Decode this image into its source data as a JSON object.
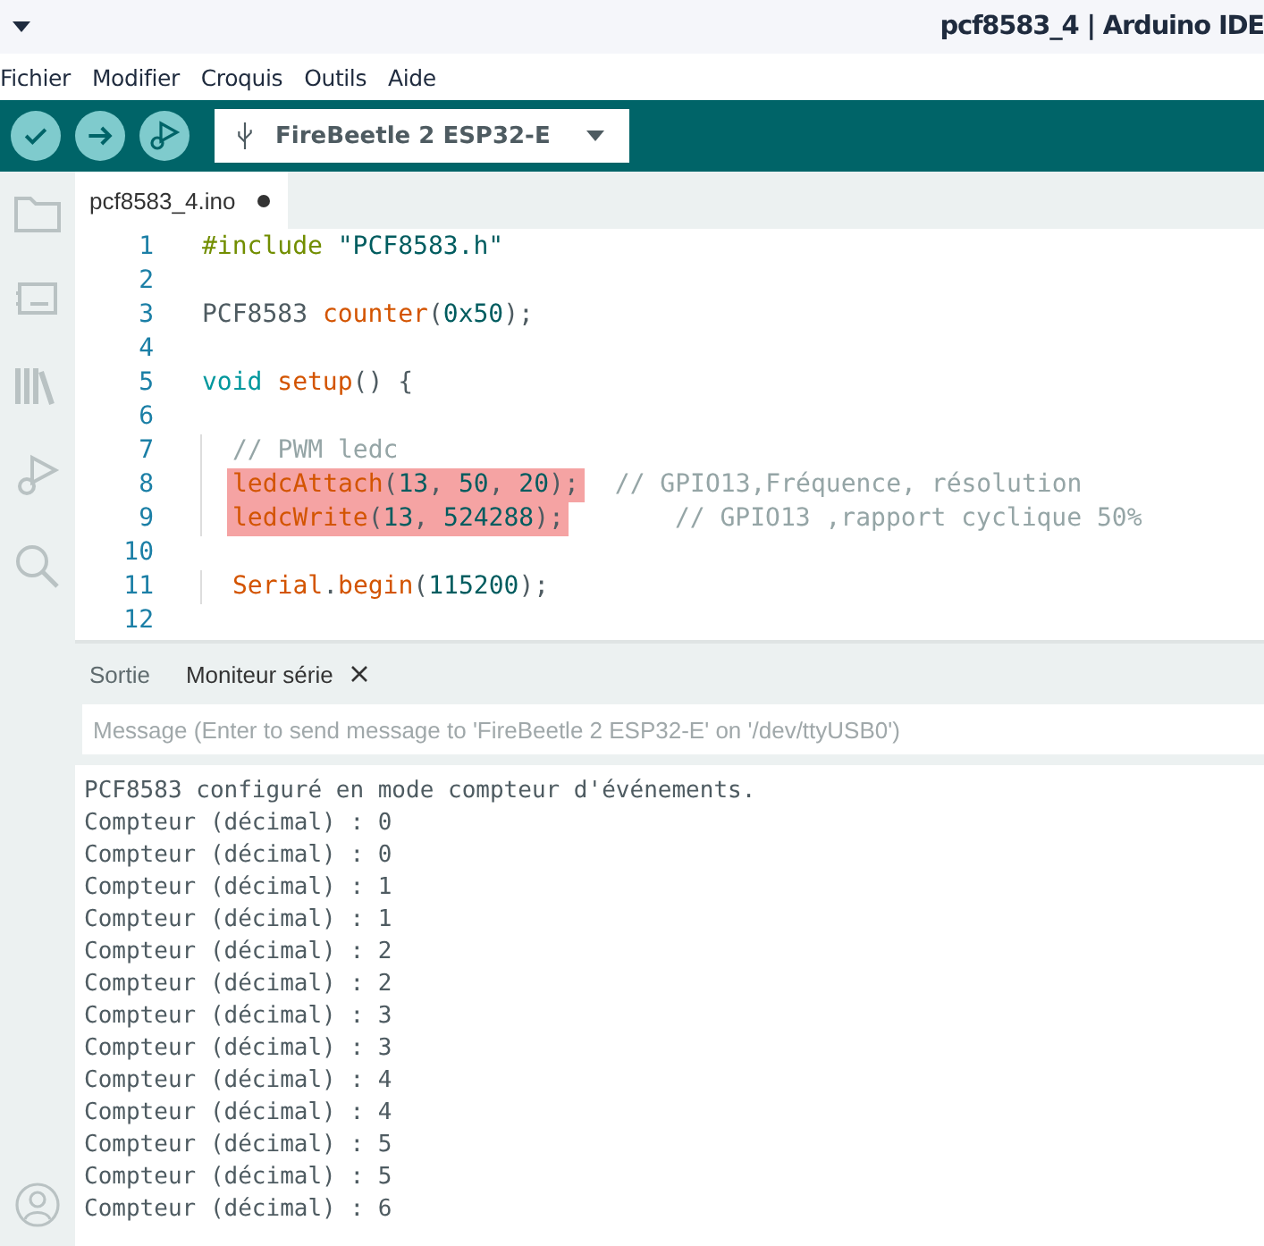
{
  "window": {
    "title": "pcf8583_4 | Arduino IDE"
  },
  "menu": [
    "Fichier",
    "Modifier",
    "Croquis",
    "Outils",
    "Aide"
  ],
  "toolbar": {
    "board": "FireBeetle 2 ESP32-E"
  },
  "editor_tabs": [
    {
      "label": "pcf8583_4.ino",
      "modified": true,
      "selected": true
    }
  ],
  "code": [
    {
      "number": "1",
      "tokens": [
        {
          "text": "#include",
          "kind": "directive"
        },
        {
          "text": " \"PCF8583.h\"",
          "kind": "string"
        }
      ]
    },
    {
      "number": "2"
    },
    {
      "number": "3",
      "tokens": [
        {
          "text": "PCF8583 ",
          "kind": "plain"
        },
        {
          "text": "counter",
          "kind": "func"
        },
        {
          "text": "(",
          "kind": "plain"
        },
        {
          "text": "0x50",
          "kind": "number"
        },
        {
          "text": ");",
          "kind": "plain"
        }
      ]
    },
    {
      "number": "4"
    },
    {
      "number": "5",
      "tokens": [
        {
          "text": "void",
          "kind": "keyword"
        },
        {
          "text": " setup",
          "kind": "func"
        },
        {
          "text": "() {",
          "kind": "plain"
        }
      ]
    },
    {
      "number": "6"
    },
    {
      "number": "7",
      "indented": true,
      "tokens": [
        {
          "text": "// PWM ledc",
          "kind": "comment"
        }
      ]
    },
    {
      "number": "8",
      "indented": true,
      "highlighted": true,
      "tokens": [
        {
          "text": "ledcAttach",
          "kind": "func"
        },
        {
          "text": "(",
          "kind": "plain"
        },
        {
          "text": "13",
          "kind": "number"
        },
        {
          "text": ", ",
          "kind": "plain"
        },
        {
          "text": "50",
          "kind": "number"
        },
        {
          "text": ", ",
          "kind": "plain"
        },
        {
          "text": "20",
          "kind": "number"
        },
        {
          "text": ");",
          "kind": "plain"
        }
      ],
      "comment": "// GPIO13,Fréquence, résolution"
    },
    {
      "number": "9",
      "indented": true,
      "highlighted": true,
      "tokens": [
        {
          "text": "ledcWrite",
          "kind": "func"
        },
        {
          "text": "(",
          "kind": "plain"
        },
        {
          "text": "13",
          "kind": "number"
        },
        {
          "text": ", ",
          "kind": "plain"
        },
        {
          "text": "524288",
          "kind": "number"
        },
        {
          "text": ");",
          "kind": "plain"
        }
      ],
      "comment": "// GPIO13 ,rapport cyclique 50%",
      "comment_gap": true
    },
    {
      "number": "10"
    },
    {
      "number": "11",
      "indented": true,
      "tokens": [
        {
          "text": "Serial",
          "kind": "func"
        },
        {
          "text": ".",
          "kind": "plain"
        },
        {
          "text": "begin",
          "kind": "func"
        },
        {
          "text": "(",
          "kind": "plain"
        },
        {
          "text": "115200",
          "kind": "number"
        },
        {
          "text": ");",
          "kind": "plain"
        }
      ]
    },
    {
      "number": "12"
    }
  ],
  "panel_tabs": [
    {
      "label": "Sortie",
      "selected": false,
      "closable": false
    },
    {
      "label": "Moniteur série",
      "selected": true,
      "closable": true
    }
  ],
  "message_field": {
    "placeholder": "Message (Enter to send message to 'FireBeetle 2 ESP32-E' on '/dev/ttyUSB0')"
  },
  "serial_output": [
    "PCF8583 configuré en mode compteur d'événements.",
    "Compteur (décimal) : 0",
    "Compteur (décimal) : 0",
    "Compteur (décimal) : 1",
    "Compteur (décimal) : 1",
    "Compteur (décimal) : 2",
    "Compteur (décimal) : 2",
    "Compteur (décimal) : 3",
    "Compteur (décimal) : 3",
    "Compteur (décimal) : 4",
    "Compteur (décimal) : 4",
    "Compteur (décimal) : 5",
    "Compteur (décimal) : 5",
    "Compteur (décimal) : 6"
  ]
}
